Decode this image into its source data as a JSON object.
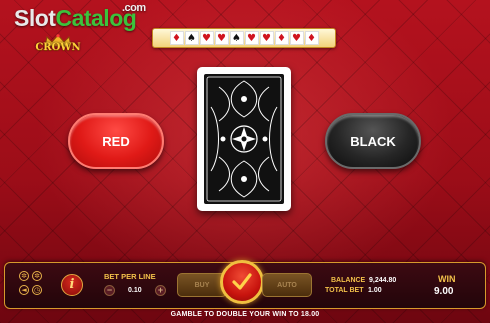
{
  "watermark": {
    "slot": "Slot",
    "catalog": "Catalog",
    "tld": ".com"
  },
  "logo": {
    "text": "CROWN"
  },
  "history": [
    {
      "suit": "♦",
      "color": "red"
    },
    {
      "suit": "♠",
      "color": "black"
    },
    {
      "suit": "♥",
      "color": "red"
    },
    {
      "suit": "♥",
      "color": "red"
    },
    {
      "suit": "♠",
      "color": "black"
    },
    {
      "suit": "♥",
      "color": "red"
    },
    {
      "suit": "♥",
      "color": "red"
    },
    {
      "suit": "♦",
      "color": "red"
    },
    {
      "suit": "♥",
      "color": "red"
    },
    {
      "suit": "♦",
      "color": "red"
    }
  ],
  "buttons": {
    "red": "RED",
    "black": "BLACK",
    "left_pill": "BUY",
    "right_pill": "AUTO"
  },
  "bet": {
    "label": "BET PER LINE",
    "value": "0.10",
    "minus": "−",
    "plus": "+"
  },
  "info_icon": "i",
  "balance": {
    "label": "BALANCE",
    "value": "9,244.80"
  },
  "total_bet": {
    "label": "TOTAL BET",
    "value": "1.00"
  },
  "win": {
    "label": "WIN",
    "value": "9.00"
  },
  "message": "GAMBLE TO DOUBLE YOUR WIN TO 18.00",
  "colors": {
    "accent_gold": "#f2c14a",
    "red_button": "#e01a17",
    "black_button": "#262626"
  }
}
